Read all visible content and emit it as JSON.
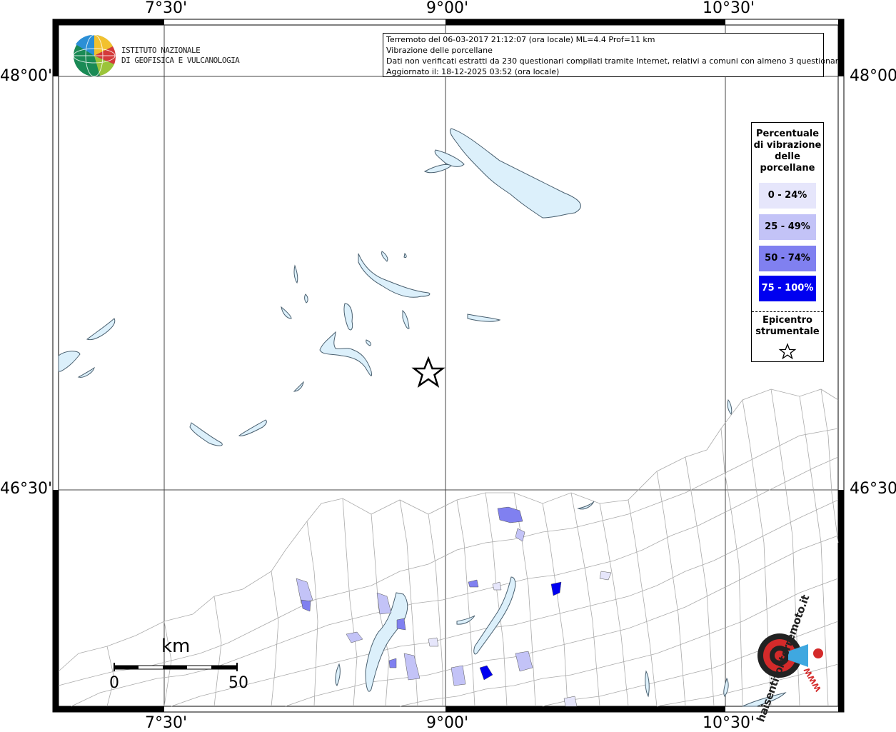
{
  "header": {
    "logo_line1": "ISTITUTO NAZIONALE",
    "logo_line2": "DI GEOFISICA E VULCANOLOGIA",
    "info_line1": "Terremoto del 06-03-2017 21:12:07 (ora locale) ML=4.4 Prof=11 km",
    "info_line2": "Vibrazione delle porcellane",
    "info_line3": "Dati non verificati estratti da 230 questionari compilati tramite Internet, relativi a comuni con almeno 3 questionari.",
    "info_line4": "Aggiornato il: 18-12-2025 03:52 (ora locale)"
  },
  "axes": {
    "lon_labels": [
      "7°30'",
      "9°00'",
      "10°30'"
    ],
    "lat_labels": [
      "48°00'",
      "46°30'"
    ]
  },
  "legend": {
    "title_lines": [
      "Percentuale",
      "di vibrazione",
      "delle",
      "porcellane"
    ],
    "items": [
      {
        "label": "0 - 24%",
        "color": "#e6e6fb",
        "text_color": "#000000"
      },
      {
        "label": "25 - 49%",
        "color": "#c3c3f7",
        "text_color": "#000000"
      },
      {
        "label": "50 - 74%",
        "color": "#8080f0",
        "text_color": "#000000"
      },
      {
        "label": "75 - 100%",
        "color": "#0000f0",
        "text_color": "#ffffff"
      }
    ],
    "epicenter_lines": [
      "Epicentro",
      "strumentale"
    ]
  },
  "scale": {
    "unit": "km",
    "start": "0",
    "end": "50"
  },
  "watermark": {
    "text": "haisentitoilterremoto.it",
    "url_text": "WWW"
  },
  "colors": {
    "lake": "#dcf0fb",
    "lake_stroke": "#4a6070",
    "border": "#999999",
    "frame": "#000000"
  }
}
